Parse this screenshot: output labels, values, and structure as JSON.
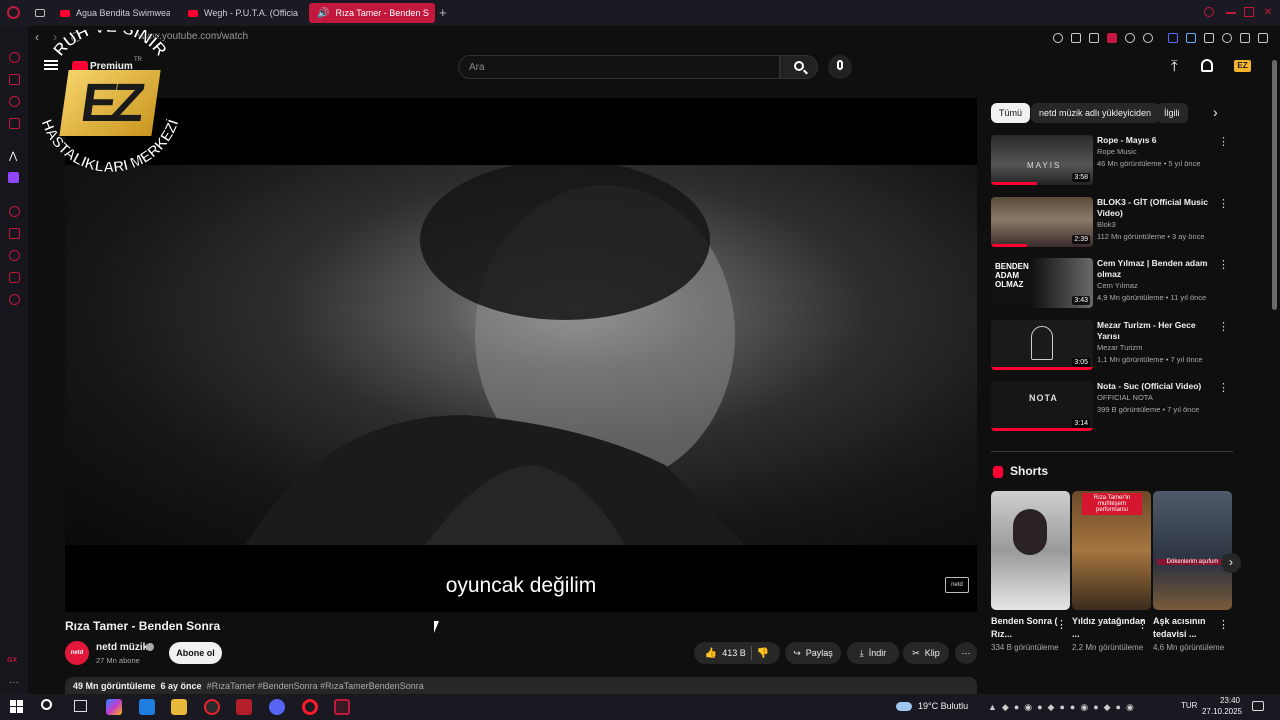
{
  "browser": {
    "tabs": [
      {
        "label": "Agua Bendita Swimwear |"
      },
      {
        "label": "Wegh - P.U.T.A. (Official"
      },
      {
        "label": "Rıza Tamer - Benden S"
      }
    ],
    "url": "www.youtube.com/watch"
  },
  "youtube": {
    "logo": "Premium",
    "logo_sup": "TR",
    "search_placeholder": "Ara"
  },
  "overlay_logo": {
    "arc_top": "RUH VE SİNİR",
    "arc_bottom": "HASTALIKLARI MERKEZİ",
    "monogram": "EZ"
  },
  "player": {
    "subtitle": "oyuncak değilim",
    "watermark": "netd"
  },
  "video": {
    "title": "Rıza Tamer - Benden Sonra",
    "channel": "netd müzik",
    "channel_avatar": "netd",
    "subscribers": "27 Mn abone",
    "subscribe_label": "Abone ol",
    "likes": "413 B",
    "share_label": "Paylaş",
    "download_label": "İndir",
    "clip_label": "Klip",
    "views": "49 Mn görüntüleme",
    "age": "6 ay önce",
    "hashtags": "#RızaTamer #BendenSonra #RızaTamerBendenSonra"
  },
  "chips": [
    {
      "label": "Tümü"
    },
    {
      "label": "netd müzik adlı yükleyiciden"
    },
    {
      "label": "İlgili"
    }
  ],
  "recommendations": [
    {
      "title": "Rope - Mayıs 6",
      "channel": "Rope Music",
      "meta": "46 Mn görüntüleme • 5 yıl önce",
      "duration": "3:58",
      "thumb_text": "MAYIS",
      "progress": 0.45
    },
    {
      "title": "BLOK3 - GİT (Official Music Video)",
      "channel": "Blok3",
      "meta": "112 Mn görüntüleme • 3 ay önce",
      "duration": "2:39",
      "thumb_text": "",
      "progress": 0.35
    },
    {
      "title": "Cem Yılmaz | Benden adam olmaz",
      "channel": "Cem Yılmaz",
      "meta": "4,9 Mn görüntüleme • 11 yıl önce",
      "duration": "3:43",
      "thumb_text": "BENDEN ADAM OLMAZ",
      "progress": 0
    },
    {
      "title": "Mezar Turizm - Her Gece Yarısı",
      "channel": "Mezar Turizm",
      "meta": "1,1 Mn görüntüleme • 7 yıl önce",
      "duration": "3:05",
      "thumb_text": "",
      "progress": 1
    },
    {
      "title": "Nota - Suc (Official Video)",
      "channel": "OFFICIAL NOTA",
      "meta": "399 B görüntüleme • 7 yıl önce",
      "duration": "3:14",
      "thumb_text": "NOTA",
      "progress": 1
    }
  ],
  "shorts": {
    "heading": "Shorts",
    "items": [
      {
        "title": "Benden Sonra ( Rız...",
        "views": "334 B görüntüleme"
      },
      {
        "title": "Yıldız yatağından ...",
        "views": "2,2 Mn görüntüleme",
        "overlay": "Rıza Tamer'in muhteşem performansı"
      },
      {
        "title": "Aşk acısının tedavisi ...",
        "views": "4,6 Mn görüntüleme",
        "overlay": "Dökenlerim aşufum"
      }
    ]
  },
  "taskbar": {
    "weather": "19°C Bulutlu",
    "lang": "TUR",
    "time": "23:40",
    "date": "27.10.2025"
  },
  "colors": {
    "accent": "#c2183e",
    "youtube_red": "#ff0033"
  }
}
